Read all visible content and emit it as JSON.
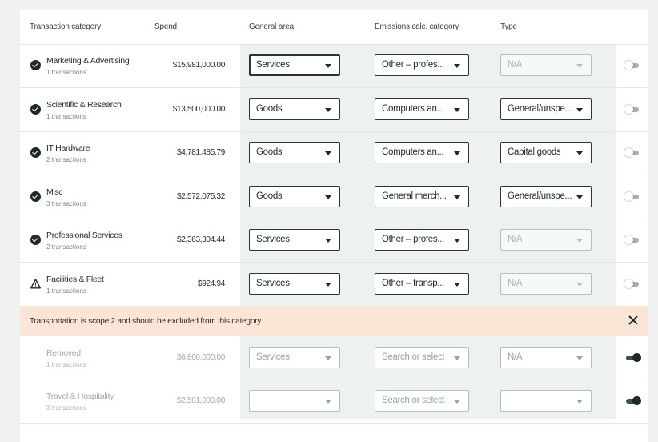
{
  "headers": {
    "category": "Transaction category",
    "spend": "Spend",
    "general_area": "General area",
    "emissions": "Emissions calc. category",
    "type": "Type"
  },
  "rows": [
    {
      "status": "check",
      "name": "Marketing & Advertising",
      "sub": "1 transactions",
      "spend": "$15,981,000.00",
      "area": "Services",
      "emis": "Other – profes...",
      "type": "N/A",
      "toggle": "off"
    },
    {
      "status": "check",
      "name": "Scientific & Research",
      "sub": "1 transactions",
      "spend": "$13,500,000.00",
      "area": "Goods",
      "emis": "Computers an...",
      "type": "General/unspe...",
      "toggle": "off"
    },
    {
      "status": "check",
      "name": "IT Hardware",
      "sub": "2 transactions",
      "spend": "$4,781,485.79",
      "area": "Goods",
      "emis": "Computers an...",
      "type": "Capital goods",
      "toggle": "off"
    },
    {
      "status": "check",
      "name": "Misc",
      "sub": "3 transactions",
      "spend": "$2,572,075.32",
      "area": "Goods",
      "emis": "General merch...",
      "type": "General/unspe...",
      "toggle": "off"
    },
    {
      "status": "check",
      "name": "Professional Services",
      "sub": "2 transactions",
      "spend": "$2,363,304.44",
      "area": "Services",
      "emis": "Other – profes...",
      "type": "N/A",
      "toggle": "off"
    },
    {
      "status": "warning",
      "name": "Facilities & Fleet",
      "sub": "1 transactions",
      "spend": "$924.94",
      "area": "Services",
      "emis": "Other – transp...",
      "type": "N/A",
      "toggle": "off"
    }
  ],
  "banner": {
    "message": "Transportation is scope 2 and should be excluded from this category"
  },
  "removed_rows": [
    {
      "name": "Removed",
      "sub": "1 transactions",
      "spend": "$6,800,000.00",
      "area": "Services",
      "emis": "Search or select",
      "type": "N/A",
      "toggle": "on"
    },
    {
      "name": "Travel & Hospitality",
      "sub": "3 transactions",
      "spend": "$2,501,000.00",
      "area": "",
      "emis": "Search or select",
      "type": "",
      "toggle": "on"
    }
  ],
  "colors": {
    "page_bg": "#f1f1f1",
    "card_bg": "#ffffff",
    "column_tint": "#eef2ef",
    "banner_bg": "#fbe5d6",
    "text_primary": "#1f2a28"
  },
  "icons": {
    "row_ok": "check-circle-icon",
    "row_warning": "warning-triangle-icon",
    "dismiss": "close-icon",
    "dropdown": "chevron-down-icon"
  }
}
